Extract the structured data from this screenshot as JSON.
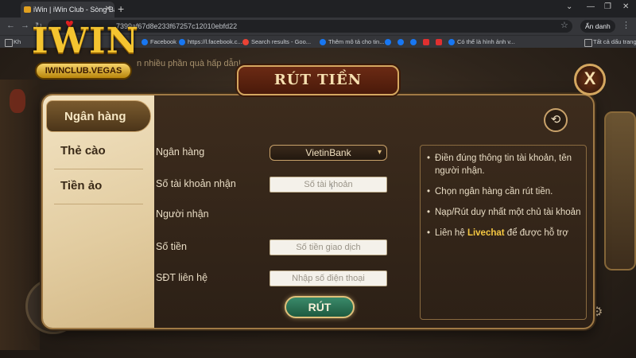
{
  "browser": {
    "tab_title": "iWin | iWin Club - Sòng Bài",
    "url": "7399af67d8e233f67257c12010ebfd22",
    "profile_label": "Ẩn danh",
    "bookmarks": [
      {
        "label": "Kh",
        "kind": "other"
      },
      {
        "label": "Facebook",
        "kind": "fb"
      },
      {
        "label": "https://l.facebook.c...",
        "kind": "fb"
      },
      {
        "label": "Search results - Goo...",
        "kind": "g"
      },
      {
        "label": "Thêm mô tả cho tin...",
        "kind": "fb"
      },
      {
        "label": "",
        "kind": "fb"
      },
      {
        "label": "",
        "kind": "fb"
      },
      {
        "label": "",
        "kind": "fb"
      },
      {
        "label": "",
        "kind": "yt"
      },
      {
        "label": "",
        "kind": "yt"
      },
      {
        "label": "Có thể là hình ảnh v...",
        "kind": "fb"
      }
    ],
    "all_bookmarks_label": "Tất cả dấu trang"
  },
  "game": {
    "marquee": "n nhiều phần quà hấp dẫn!",
    "logo_word": "IWIN",
    "logo_sub": "IWINCLUB.VEGAS"
  },
  "dialog": {
    "title": "RÚT TIỀN",
    "close_label": "X",
    "tabs": [
      {
        "label": "Ngân hàng"
      },
      {
        "label": "Thẻ cào"
      },
      {
        "label": "Tiền ảo"
      }
    ],
    "form": {
      "bank_label": "Ngân hàng",
      "bank_value": "VietinBank",
      "account_label": "Số tài khoản nhận",
      "account_placeholder": "Số tài khoản",
      "receiver_label": "Người nhận",
      "amount_label": "Số tiền",
      "amount_placeholder": "Số tiền giao dịch",
      "phone_label": "SĐT liên hệ",
      "phone_placeholder": "Nhập số điện thoại",
      "submit_label": "RÚT"
    },
    "info": {
      "item1": "Điền đúng thông tin tài khoản, tên người nhận.",
      "item2": "Chọn ngân hàng cần rút tiền.",
      "item3": "Nạp/Rút duy nhất một chủ tài khoản",
      "item4_pre": "Liên hệ ",
      "item4_hl": "Livechat",
      "item4_post": " để được hỗ trợ"
    }
  }
}
